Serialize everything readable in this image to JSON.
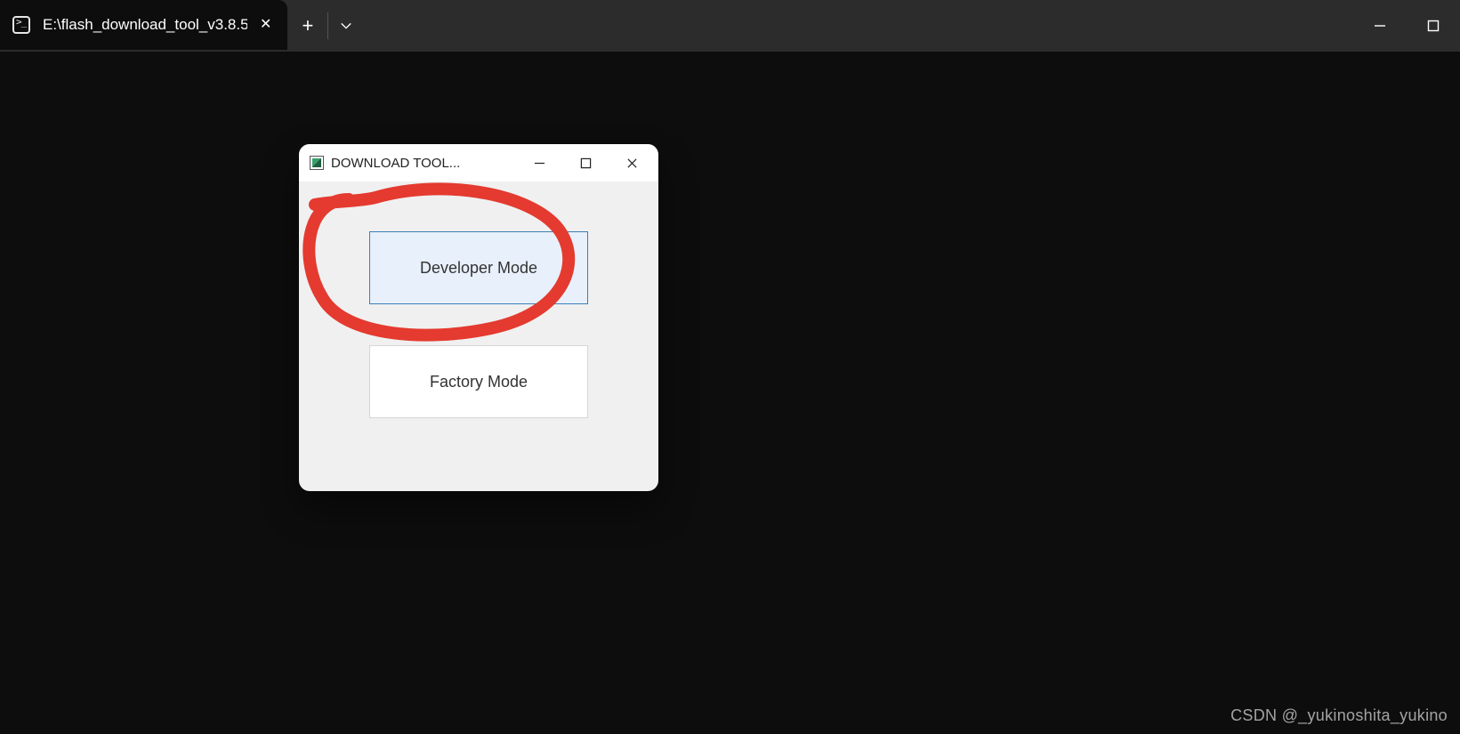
{
  "terminal": {
    "tab_title": "E:\\flash_download_tool_v3.8.5",
    "controls": {
      "minimize": "min",
      "maximize": "max"
    }
  },
  "dialog": {
    "title": "DOWNLOAD TOOL...",
    "buttons": {
      "developer": "Developer Mode",
      "factory": "Factory Mode"
    }
  },
  "watermark": "CSDN @_yukinoshita_yukino"
}
